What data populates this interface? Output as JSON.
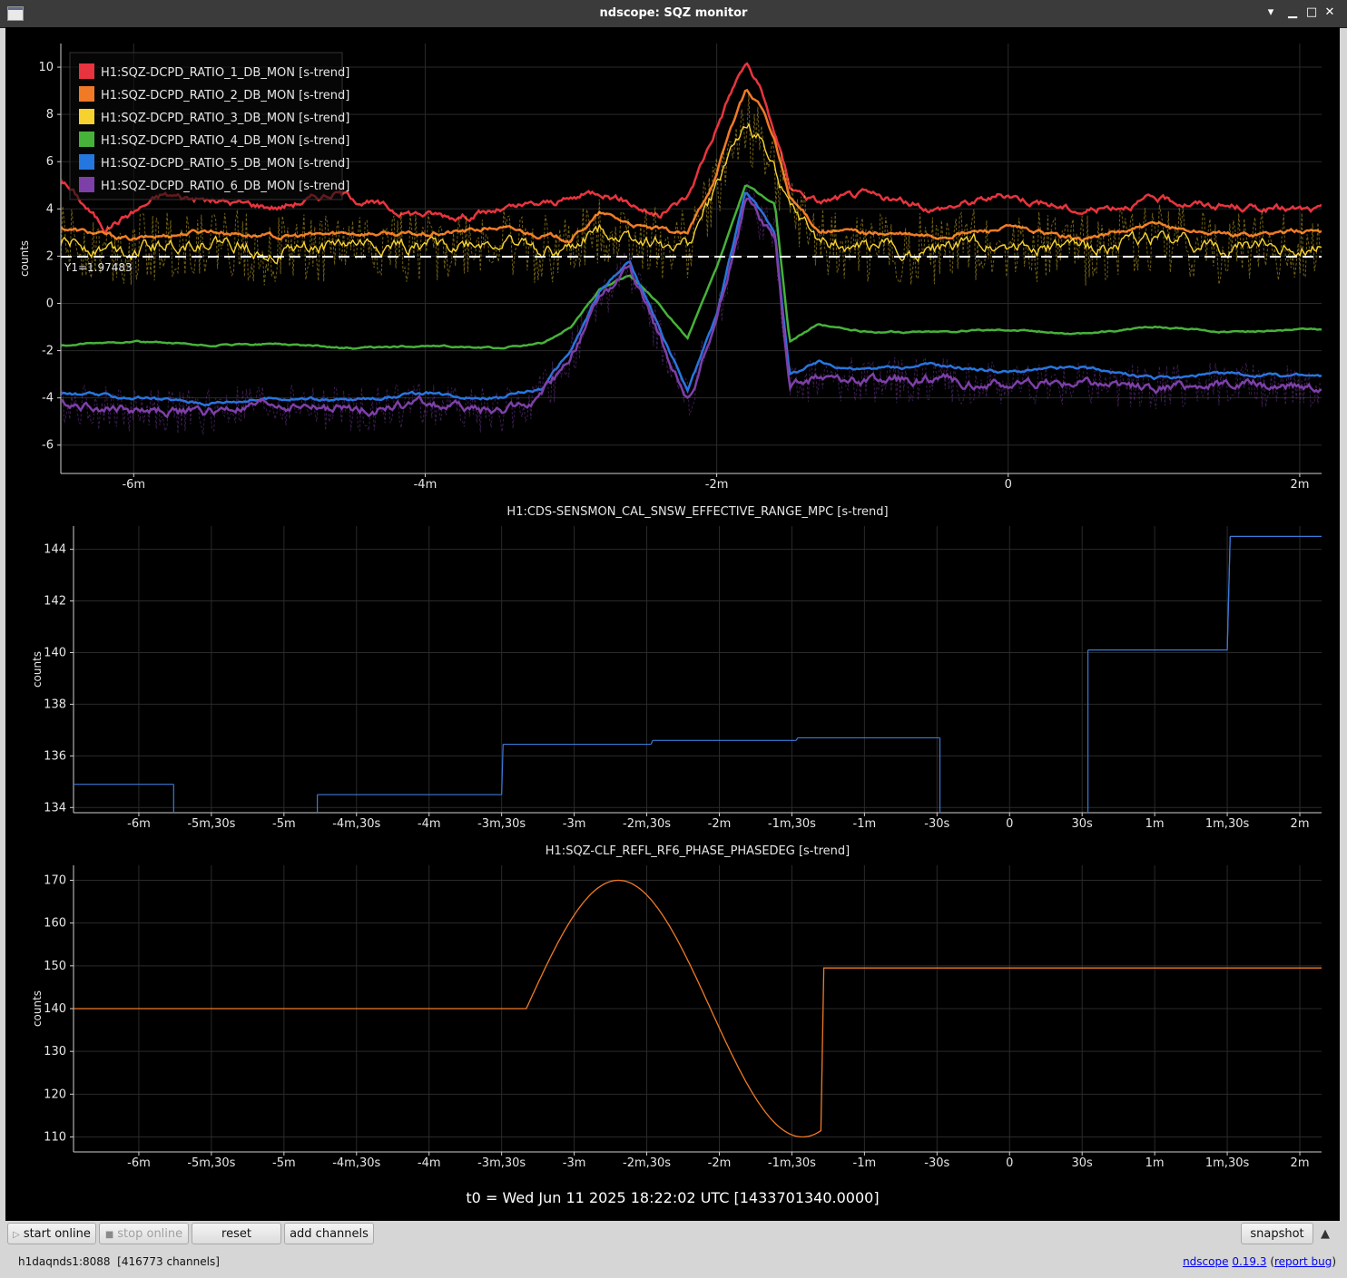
{
  "window": {
    "title": "ndscope: SQZ monitor"
  },
  "colors": {
    "ch1": "#e8343e",
    "ch2": "#f07a26",
    "ch3": "#f7d22e",
    "ch4": "#47b23a",
    "ch5": "#2577e0",
    "ch6": "#7d3fa8",
    "range": "#3a7ad8",
    "phase": "#f07a26",
    "cursor": "#ffffff"
  },
  "chart_data": [
    {
      "type": "line",
      "ylabel": "counts",
      "ylim": [
        -7.2,
        11
      ],
      "xlim": [
        -6.5,
        2.15
      ],
      "x_unit": "minutes",
      "yticks": [
        "-6",
        "-4",
        "-2",
        "0",
        "2",
        "4",
        "6",
        "8",
        "10"
      ],
      "xticks": [
        {
          "x": -6,
          "label": "-6m"
        },
        {
          "x": -4,
          "label": "-4m"
        },
        {
          "x": -2,
          "label": "-2m"
        },
        {
          "x": 0,
          "label": "0"
        },
        {
          "x": 2,
          "label": "2m"
        }
      ],
      "cursor": {
        "y": 1.97483,
        "label": "Y1=1.97483"
      },
      "series": [
        {
          "name": "H1:SQZ-DCPD_RATIO_1_DB_MON [s-trend]",
          "color": "#e8343e",
          "x": [
            -6.5,
            -6.2,
            -5.8,
            -5.4,
            -5.0,
            -4.6,
            -4.2,
            -3.8,
            -3.4,
            -3.0,
            -2.8,
            -2.6,
            -2.4,
            -2.2,
            -2.0,
            -1.9,
            -1.8,
            -1.7,
            -1.6,
            -1.5,
            -1.3,
            -1.0,
            -0.5,
            0.0,
            0.5,
            1.0,
            1.5,
            2.15
          ],
          "values": [
            5.3,
            3.2,
            4.6,
            4.3,
            4.1,
            4.7,
            3.9,
            3.7,
            4.0,
            4.4,
            4.8,
            4.3,
            3.7,
            4.5,
            7.5,
            9.0,
            10.2,
            9.0,
            7.2,
            5.0,
            4.3,
            4.6,
            4.0,
            4.6,
            3.9,
            4.4,
            4.1,
            3.9
          ]
        },
        {
          "name": "H1:SQZ-DCPD_RATIO_2_DB_MON [s-trend]",
          "color": "#f07a26",
          "x": [
            -6.5,
            -6.0,
            -5.5,
            -5.0,
            -4.5,
            -4.0,
            -3.5,
            -3.0,
            -2.8,
            -2.5,
            -2.2,
            -2.0,
            -1.9,
            -1.8,
            -1.7,
            -1.6,
            -1.5,
            -1.3,
            -1.0,
            -0.5,
            0.0,
            0.5,
            1.0,
            1.5,
            2.15
          ],
          "values": [
            3.2,
            2.7,
            3.1,
            2.8,
            3.0,
            2.9,
            3.2,
            2.7,
            3.8,
            3.2,
            2.9,
            5.5,
            7.5,
            9.0,
            8.4,
            6.8,
            4.5,
            3.1,
            3.0,
            2.8,
            3.2,
            2.7,
            3.3,
            2.9,
            3.1
          ]
        },
        {
          "name": "H1:SQZ-DCPD_RATIO_3_DB_MON [s-trend]",
          "color": "#f7d22e",
          "x": [
            -6.5,
            -6.0,
            -5.5,
            -5.0,
            -4.5,
            -4.0,
            -3.5,
            -3.0,
            -2.8,
            -2.5,
            -2.2,
            -2.0,
            -1.9,
            -1.8,
            -1.7,
            -1.6,
            -1.5,
            -1.3,
            -1.0,
            -0.5,
            0.0,
            0.5,
            1.0,
            1.5,
            2.15
          ],
          "values": [
            2.6,
            2.3,
            2.7,
            2.2,
            2.5,
            2.4,
            2.6,
            2.2,
            3.2,
            2.7,
            2.4,
            4.8,
            6.5,
            7.5,
            7.0,
            5.8,
            3.9,
            2.5,
            2.4,
            2.3,
            2.6,
            2.2,
            2.7,
            2.3,
            2.5
          ]
        },
        {
          "name": "H1:SQZ-DCPD_RATIO_4_DB_MON [s-trend]",
          "color": "#47b23a",
          "x": [
            -6.5,
            -6.0,
            -5.5,
            -5.0,
            -4.5,
            -4.0,
            -3.5,
            -3.2,
            -3.0,
            -2.8,
            -2.6,
            -2.4,
            -2.2,
            -2.0,
            -1.8,
            -1.6,
            -1.5,
            -1.3,
            -1.0,
            -0.5,
            0.0,
            0.5,
            1.0,
            1.5,
            2.15
          ],
          "values": [
            -1.8,
            -1.6,
            -1.8,
            -1.7,
            -1.9,
            -1.8,
            -1.9,
            -1.7,
            -1.0,
            0.6,
            1.2,
            0.0,
            -1.5,
            1.5,
            5.0,
            4.2,
            -1.6,
            -0.9,
            -1.2,
            -1.2,
            -1.1,
            -1.3,
            -1.0,
            -1.2,
            -1.1
          ]
        },
        {
          "name": "H1:SQZ-DCPD_RATIO_5_DB_MON [s-trend]",
          "color": "#2577e0",
          "x": [
            -6.5,
            -6.0,
            -5.5,
            -5.0,
            -4.5,
            -4.0,
            -3.5,
            -3.2,
            -3.0,
            -2.8,
            -2.6,
            -2.4,
            -2.2,
            -2.0,
            -1.8,
            -1.6,
            -1.5,
            -1.3,
            -1.0,
            -0.5,
            0.0,
            0.5,
            1.0,
            1.5,
            2.15
          ],
          "values": [
            -3.8,
            -4.0,
            -4.2,
            -4.0,
            -4.1,
            -3.8,
            -4.0,
            -3.6,
            -2.0,
            0.5,
            1.8,
            -1.0,
            -3.7,
            -0.5,
            4.8,
            3.0,
            -3.0,
            -2.5,
            -2.8,
            -2.6,
            -2.9,
            -2.7,
            -3.2,
            -3.0,
            -3.1
          ]
        },
        {
          "name": "H1:SQZ-DCPD_RATIO_6_DB_MON [s-trend]",
          "color": "#7d3fa8",
          "x": [
            -6.5,
            -6.0,
            -5.5,
            -5.0,
            -4.5,
            -4.0,
            -3.5,
            -3.2,
            -3.0,
            -2.8,
            -2.6,
            -2.4,
            -2.2,
            -2.0,
            -1.8,
            -1.6,
            -1.5,
            -1.3,
            -1.0,
            -0.5,
            0.0,
            0.5,
            1.0,
            1.5,
            2.15
          ],
          "values": [
            -4.2,
            -4.5,
            -4.6,
            -4.3,
            -4.5,
            -4.2,
            -4.6,
            -4.0,
            -2.2,
            0.2,
            1.4,
            -1.3,
            -4.2,
            -0.8,
            4.4,
            2.6,
            -3.6,
            -3.1,
            -3.3,
            -3.2,
            -3.5,
            -3.3,
            -3.6,
            -3.4,
            -3.5
          ]
        }
      ]
    },
    {
      "type": "line",
      "title": "H1:CDS-SENSMON_CAL_SNSW_EFFECTIVE_RANGE_MPC [s-trend]",
      "ylabel": "counts",
      "ylim": [
        133.8,
        144.9
      ],
      "xlim": [
        -6.45,
        2.15
      ],
      "x_unit": "minutes",
      "yticks": [
        "134",
        "136",
        "138",
        "140",
        "142",
        "144"
      ],
      "xticks": [
        {
          "x": -6,
          "label": "-6m"
        },
        {
          "x": -5.5,
          "label": "-5m,30s"
        },
        {
          "x": -5,
          "label": "-5m"
        },
        {
          "x": -4.5,
          "label": "-4m,30s"
        },
        {
          "x": -4,
          "label": "-4m"
        },
        {
          "x": -3.5,
          "label": "-3m,30s"
        },
        {
          "x": -3,
          "label": "-3m"
        },
        {
          "x": -2.5,
          "label": "-2m,30s"
        },
        {
          "x": -2,
          "label": "-2m"
        },
        {
          "x": -1.5,
          "label": "-1m,30s"
        },
        {
          "x": -1,
          "label": "-1m"
        },
        {
          "x": -0.5,
          "label": "-30s"
        },
        {
          "x": 0,
          "label": "0"
        },
        {
          "x": 0.5,
          "label": "30s"
        },
        {
          "x": 1,
          "label": "1m"
        },
        {
          "x": 1.5,
          "label": "1m,30s"
        },
        {
          "x": 2,
          "label": "2m"
        }
      ],
      "series": [
        {
          "color": "#3a7ad8",
          "segments": [
            {
              "x": [
                -6.45,
                -5.76
              ],
              "values": [
                134.9,
                134.9
              ]
            },
            {
              "x": [
                -4.77,
                -3.5
              ],
              "values": [
                134.5,
                134.5
              ]
            },
            {
              "x": [
                -3.49,
                -2.47
              ],
              "values": [
                136.45,
                136.45
              ]
            },
            {
              "x": [
                -2.46,
                -1.47
              ],
              "values": [
                136.6,
                136.6
              ]
            },
            {
              "x": [
                -1.46,
                -0.48
              ],
              "values": [
                136.7,
                136.7
              ]
            },
            {
              "x": [
                0.54,
                1.5
              ],
              "values": [
                140.1,
                140.1
              ]
            },
            {
              "x": [
                1.52,
                2.15
              ],
              "values": [
                144.5,
                144.5
              ]
            }
          ]
        }
      ]
    },
    {
      "type": "line",
      "title": "H1:SQZ-CLF_REFL_RF6_PHASE_PHASEDEG [s-trend]",
      "ylabel": "counts",
      "ylim": [
        106.5,
        173.5
      ],
      "xlim": [
        -6.45,
        2.15
      ],
      "x_unit": "minutes",
      "yticks": [
        "110",
        "120",
        "130",
        "140",
        "150",
        "160",
        "170"
      ],
      "xticks": [
        {
          "x": -6,
          "label": "-6m"
        },
        {
          "x": -5.5,
          "label": "-5m,30s"
        },
        {
          "x": -5,
          "label": "-5m"
        },
        {
          "x": -4.5,
          "label": "-4m,30s"
        },
        {
          "x": -4,
          "label": "-4m"
        },
        {
          "x": -3.5,
          "label": "-3m,30s"
        },
        {
          "x": -3,
          "label": "-3m"
        },
        {
          "x": -2.5,
          "label": "-2m,30s"
        },
        {
          "x": -2,
          "label": "-2m"
        },
        {
          "x": -1.5,
          "label": "-1m,30s"
        },
        {
          "x": -1,
          "label": "-1m"
        },
        {
          "x": -0.5,
          "label": "-30s"
        },
        {
          "x": 0,
          "label": "0"
        },
        {
          "x": 0.5,
          "label": "30s"
        },
        {
          "x": 1,
          "label": "1m"
        },
        {
          "x": 1.5,
          "label": "1m,30s"
        },
        {
          "x": 2,
          "label": "2m"
        }
      ],
      "series": [
        {
          "color": "#f07a26",
          "x": [
            -6.45,
            -3.33,
            -3.2,
            -3.0,
            -2.8,
            -2.6,
            -2.45,
            -2.3,
            -2.1,
            -1.9,
            -1.75,
            -1.6,
            -1.4,
            -1.3,
            -1.28,
            -2.15
          ],
          "values": [
            140,
            140,
            145,
            159,
            168,
            170,
            166,
            156,
            138,
            119,
            110,
            112,
            126,
            138,
            149.5,
            149.5
          ]
        }
      ]
    }
  ],
  "t0_label": "t0 = Wed Jun 11 2025 18:22:02 UTC [1433701340.0000]",
  "toolbar": {
    "start_online": "start online",
    "stop_online": "stop online",
    "reset": "reset",
    "add_channels": "add channels",
    "snapshot": "snapshot"
  },
  "status": {
    "server": "h1daqnds1:8088",
    "channels": "[416773 channels]",
    "app": "ndscope",
    "version": "0.19.3",
    "report": "report bug"
  }
}
